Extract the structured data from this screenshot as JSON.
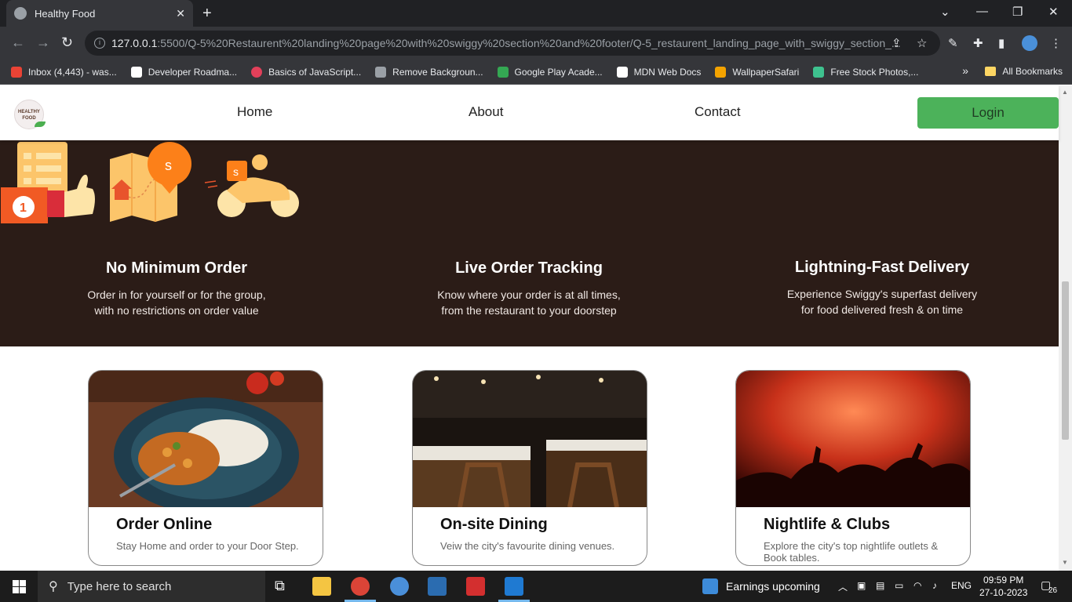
{
  "browser": {
    "tab_title": "Healthy Food",
    "new_tab": "+",
    "url_host": "127.0.0.1",
    "url_path": ":5500/Q-5%20Restaurent%20landing%20page%20with%20swiggy%20section%20and%20footer/Q-5_restaurent_landing_page_with_swiggy_section_...",
    "bookmarks": [
      {
        "label": "Inbox (4,443) - was...",
        "color": "#ea4335"
      },
      {
        "label": "Developer Roadma...",
        "color": "#ffffff"
      },
      {
        "label": "Basics of JavaScript...",
        "color": "#e2405a"
      },
      {
        "label": "Remove Backgroun...",
        "color": "#9aa0a6"
      },
      {
        "label": "Google Play Acade...",
        "color": "#34a853"
      },
      {
        "label": "MDN Web Docs",
        "color": "#ffffff"
      },
      {
        "label": "WallpaperSafari",
        "color": "#f4a300"
      },
      {
        "label": "Free Stock Photos,...",
        "color": "#3ec28f"
      }
    ],
    "all_bookmarks": "All Bookmarks",
    "more_bookmarks": "»"
  },
  "page": {
    "logo_text": "HEALTHY FOOD",
    "nav": {
      "home": "Home",
      "about": "About",
      "contact": "Contact",
      "login": "Login"
    },
    "features": [
      {
        "title": "No Minimum Order",
        "desc1": "Order in for yourself or for the group,",
        "desc2": "with no restrictions on order value",
        "icon": "thumbs-up-checklist-icon"
      },
      {
        "title": "Live Order Tracking",
        "desc1": "Know where your order is at all times,",
        "desc2": "from the restaurant to your doorstep",
        "icon": "map-pin-icon"
      },
      {
        "title": "Lightning-Fast Delivery",
        "desc1": "Experience Swiggy's superfast delivery",
        "desc2": "for food delivered fresh & on time",
        "icon": "delivery-scooter-icon"
      }
    ],
    "cards": [
      {
        "title": "Order Online",
        "desc": "Stay Home and order to your Door Step."
      },
      {
        "title": "On-site Dining",
        "desc": "Veiw the city's favourite dining venues."
      },
      {
        "title": "Nightlife & Clubs",
        "desc": "Explore the city's top nightlife outlets & Book tables."
      }
    ]
  },
  "taskbar": {
    "search_placeholder": "Type here to search",
    "news": "Earnings upcoming",
    "lang": "ENG",
    "time": "09:59 PM",
    "date": "27-10-2023",
    "notifications": "26"
  }
}
